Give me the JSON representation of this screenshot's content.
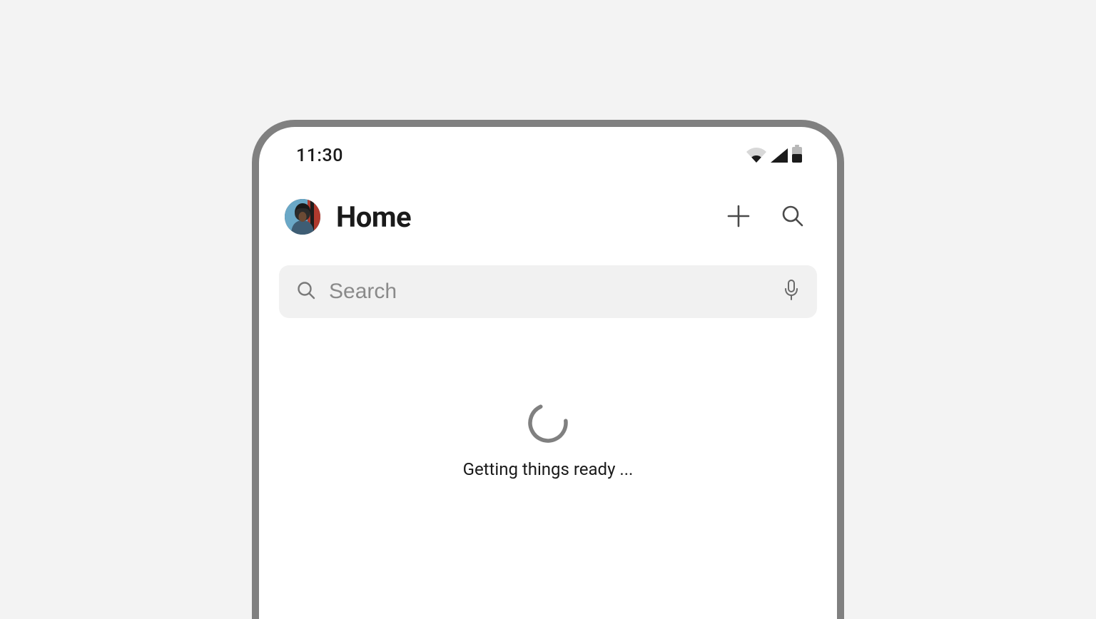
{
  "statusbar": {
    "time": "11:30"
  },
  "header": {
    "title": "Home"
  },
  "search": {
    "placeholder": "Search"
  },
  "loading": {
    "text": "Getting things ready ..."
  }
}
